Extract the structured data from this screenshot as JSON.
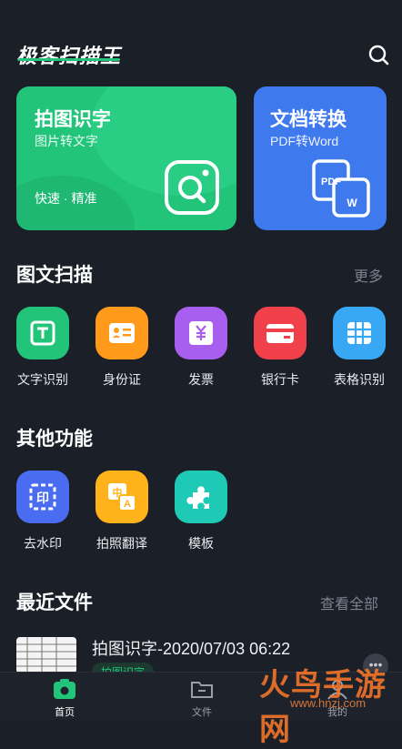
{
  "app": {
    "title": "极客扫描王"
  },
  "cards": {
    "ocr": {
      "title": "拍图识字",
      "subtitle": "图片转文字",
      "tag": "快速 · 精准"
    },
    "convert": {
      "title": "文档转换",
      "subtitle": "PDF转Word",
      "icon_text": "PDF",
      "icon_text2": "W"
    }
  },
  "scan_section": {
    "title": "图文扫描",
    "more": "更多",
    "tools": [
      {
        "label": "文字识别",
        "icon": "text-recognition-icon",
        "color": "#22c47a"
      },
      {
        "label": "身份证",
        "icon": "id-card-icon",
        "color": "#ff9a1a"
      },
      {
        "label": "发票",
        "icon": "invoice-icon",
        "color": "#a85ff0"
      },
      {
        "label": "银行卡",
        "icon": "bank-card-icon",
        "color": "#f0414a"
      },
      {
        "label": "表格识别",
        "icon": "table-icon",
        "color": "#38a8f5"
      }
    ]
  },
  "other_section": {
    "title": "其他功能",
    "tools": [
      {
        "label": "去水印",
        "icon": "watermark-remove-icon",
        "color": "#4a6cf0",
        "glyph": "印"
      },
      {
        "label": "拍照翻译",
        "icon": "translate-icon",
        "color": "#ffb21a",
        "glyph": "中",
        "glyph2": "A"
      },
      {
        "label": "模板",
        "icon": "puzzle-icon",
        "color": "#1ec9b6"
      }
    ]
  },
  "recent_section": {
    "title": "最近文件",
    "more": "查看全部",
    "file": {
      "name": "拍图识字-2020/07/03 06:22",
      "badge": "拍图识字"
    }
  },
  "tabbar": {
    "tabs": [
      {
        "label": "首页",
        "icon": "camera-home-icon",
        "active": true
      },
      {
        "label": "文件",
        "icon": "folder-icon",
        "active": false
      },
      {
        "label": "我的",
        "icon": "profile-icon",
        "active": false
      }
    ]
  },
  "watermark": {
    "text": "火鸟手游网",
    "url": "www.hnzj.com"
  }
}
